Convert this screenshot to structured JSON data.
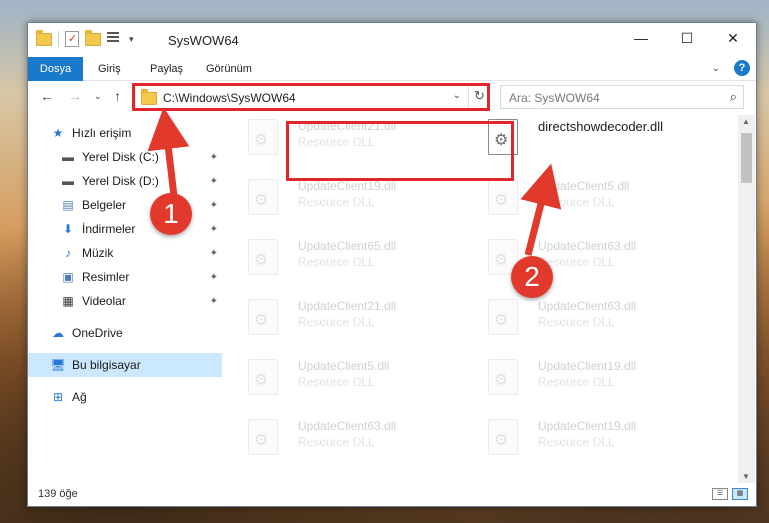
{
  "window": {
    "title": "SysWOW64",
    "minimize": "—",
    "maximize": "☐",
    "close": "✕"
  },
  "ribbon": {
    "tabs": [
      "Dosya",
      "Giriş",
      "Paylaş",
      "Görünüm"
    ],
    "help": "?"
  },
  "address": {
    "path": "C:\\Windows\\SysWOW64",
    "search_placeholder": "Ara: SysWOW64"
  },
  "sidebar": {
    "items": [
      {
        "label": "Hızlı erişim",
        "icon": "star-icon"
      },
      {
        "label": "Yerel Disk (C:)",
        "icon": "drive-icon",
        "pinned": true
      },
      {
        "label": "Yerel Disk (D:)",
        "icon": "drive-icon",
        "pinned": true
      },
      {
        "label": "Belgeler",
        "icon": "documents-icon",
        "pinned": true
      },
      {
        "label": "İndirmeler",
        "icon": "download-icon",
        "pinned": true
      },
      {
        "label": "Müzik",
        "icon": "music-icon",
        "pinned": true
      },
      {
        "label": "Resimler",
        "icon": "pictures-icon",
        "pinned": true
      },
      {
        "label": "Videolar",
        "icon": "videos-icon",
        "pinned": true
      },
      {
        "label": "OneDrive",
        "icon": "cloud-icon"
      },
      {
        "label": "Bu bilgisayar",
        "icon": "computer-icon"
      },
      {
        "label": "Ağ",
        "icon": "network-icon"
      }
    ]
  },
  "files": {
    "type_label": "Resource DLL",
    "left": [
      "UpdateClient21.dll",
      "UpdateClient19.dll",
      "UpdateClient65.dll",
      "UpdateClient21.dll",
      "UpdateClient5.dll",
      "UpdateClient63.dll"
    ],
    "right": [
      "UpdateClient5.dll",
      "UpdateClient63.dll",
      "UpdateClient63.dll",
      "UpdateClient19.dll",
      "UpdateClient19.dll"
    ],
    "highlighted": "directshowdecoder.dll"
  },
  "annotations": {
    "step1": "1",
    "step2": "2",
    "color": "#e2392d"
  },
  "status": {
    "count": "139 öğe"
  }
}
